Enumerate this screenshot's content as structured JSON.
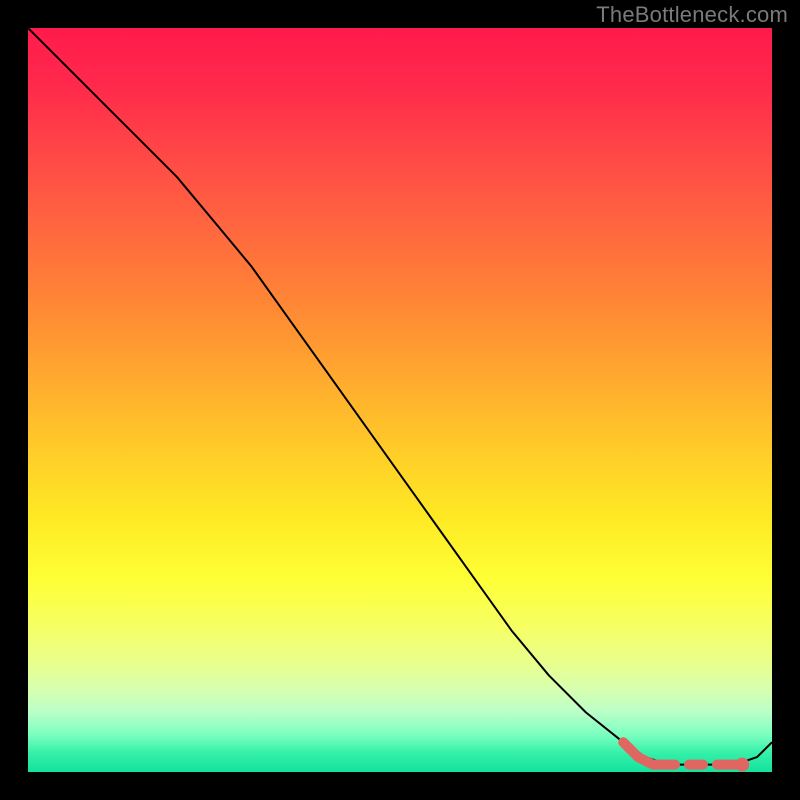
{
  "watermark": "TheBottleneck.com",
  "chart_data": {
    "type": "line",
    "title": "",
    "xlabel": "",
    "ylabel": "",
    "xlim": [
      0,
      100
    ],
    "ylim": [
      0,
      100
    ],
    "grid": false,
    "legend": false,
    "series": [
      {
        "name": "bottleneck-curve",
        "color": "#000000",
        "x": [
          0,
          5,
          10,
          15,
          20,
          25,
          30,
          35,
          40,
          45,
          50,
          55,
          60,
          65,
          70,
          75,
          80,
          83,
          86,
          89,
          92,
          95,
          98,
          100
        ],
        "y": [
          100,
          95,
          90,
          85,
          80,
          74,
          68,
          61,
          54,
          47,
          40,
          33,
          26,
          19,
          13,
          8,
          4,
          2,
          1,
          1,
          1,
          1,
          2,
          4
        ]
      },
      {
        "name": "optimal-range-marker",
        "color": "#e06662",
        "style": "dashed",
        "x": [
          80,
          82,
          84,
          86,
          88,
          90,
          92,
          94,
          96
        ],
        "y": [
          4,
          2,
          1,
          1,
          1,
          1,
          1,
          1,
          1
        ]
      }
    ],
    "background_gradient": {
      "direction": "vertical",
      "stops": [
        {
          "pos": 0.0,
          "color": "#ff1a4d"
        },
        {
          "pos": 0.5,
          "color": "#ffad2e"
        },
        {
          "pos": 0.75,
          "color": "#feff35"
        },
        {
          "pos": 1.0,
          "color": "#13e29d"
        }
      ]
    }
  }
}
